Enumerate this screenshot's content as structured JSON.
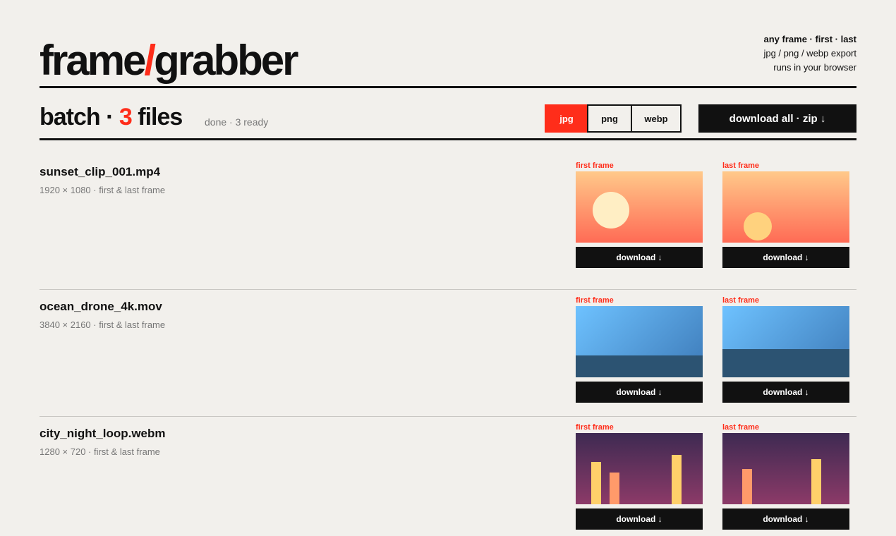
{
  "app": {
    "logo_part1": "frame",
    "logo_slash": "/",
    "logo_part2": "grabber",
    "tagline_1": "any frame · first · last",
    "tagline_2": "jpg / png / webp export",
    "tagline_3": "runs in your browser"
  },
  "batch": {
    "prefix": "batch · ",
    "count": "3",
    "suffix": " files",
    "status": "done · 3 ready",
    "formats": [
      "jpg",
      "png",
      "webp"
    ],
    "selected_format": "jpg",
    "download_all_label": "download all · zip ↓"
  },
  "files": [
    {
      "name": "sunset_clip_001.mp4",
      "meta": "1920 × 1080 · first & last frame",
      "first_label": "first frame",
      "last_label": "last frame",
      "download_label": "download ↓"
    },
    {
      "name": "ocean_drone_4k.mov",
      "meta": "3840 × 2160 · first & last frame",
      "first_label": "first frame",
      "last_label": "last frame",
      "download_label": "download ↓"
    },
    {
      "name": "city_night_loop.webm",
      "meta": "1280 × 720 · first & last frame",
      "first_label": "first frame",
      "last_label": "last frame",
      "download_label": "download ↓"
    }
  ],
  "colors": {
    "accent": "#ff2d1a",
    "ink": "#111111",
    "background": "#f2f0ec",
    "muted": "#777777"
  }
}
